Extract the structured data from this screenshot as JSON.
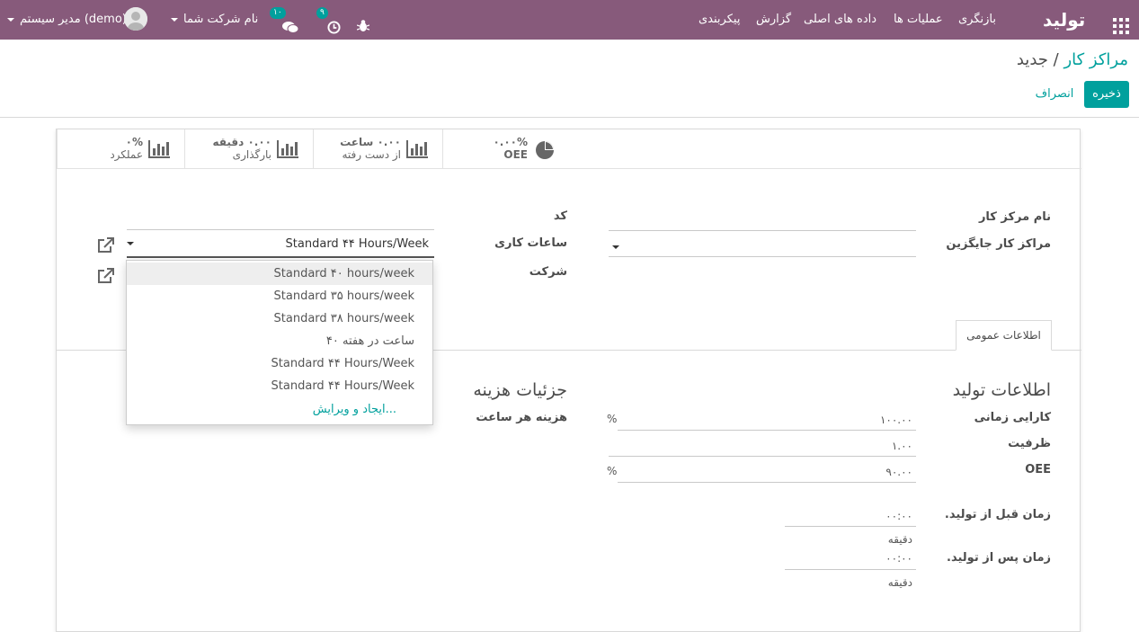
{
  "navbar": {
    "brand": "تولید",
    "menu": [
      "بازنگری",
      "عملیات ها",
      "داده های اصلی",
      "گزارش",
      "پیکربندی"
    ],
    "user": "مدیر سیستم (demo)",
    "company": "نام شرکت شما",
    "messages_badge": "۱۰",
    "activities_badge": "۹"
  },
  "breadcrumb": {
    "parent": "مراکز کار",
    "separator": "/",
    "current": "جدید"
  },
  "buttons": {
    "save": "ذخیره",
    "discard": "انصراف"
  },
  "stats": [
    {
      "value": "۰.۰۰%",
      "label": "OEE"
    },
    {
      "value": "۰.۰۰ ساعت",
      "label": "از دست رفته"
    },
    {
      "value": "۰.۰۰ دقیقه",
      "label": "بارگذاری"
    },
    {
      "value": "۰%",
      "label": "عملکرد"
    }
  ],
  "form": {
    "name_label": "نام مرکز کار",
    "alt_label": "مراکز کار جایگزین",
    "code_label": "کد",
    "hours_label": "ساعات کاری",
    "company_label": "شرکت",
    "hours_value": "Standard ۴۴ Hours/Week"
  },
  "tab": "اطلاعات عمومی",
  "production": {
    "title": "اطلاعات تولید",
    "time_eff_label": "کارایی زمانی",
    "time_eff_value": "۱۰۰.۰۰",
    "capacity_label": "ظرفیت",
    "capacity_value": "۱.۰۰",
    "oee_label": "OEE",
    "oee_value": "۹۰.۰۰",
    "percent": "%",
    "before_label": "زمان قبل از تولید.",
    "before_value": "۰۰:۰۰",
    "after_label": "زمان پس از تولید.",
    "after_value": "۰۰:۰۰",
    "minutes": "دقیقه"
  },
  "cost": {
    "title": "جزئیات هزینه",
    "hourly_label": "هزینه هر ساعت"
  },
  "dropdown": {
    "items": [
      "Standard ۴۰ hours/week",
      "Standard ۳۵ hours/week",
      "Standard ۳۸ hours/week",
      "۴۰ ساعت در هفته",
      "Standard ۴۴ Hours/Week",
      "Standard ۴۴ Hours/Week"
    ],
    "create": "ایجاد و ویرایش..."
  },
  "colors": {
    "navbar": "#875a7b",
    "accent": "#00a09d"
  }
}
